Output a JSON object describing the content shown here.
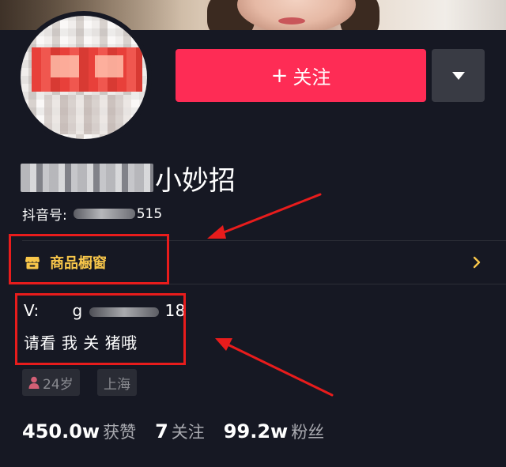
{
  "profile": {
    "follow_button_label": "关注",
    "follow_button_icon": "plus-icon",
    "more_button_icon": "dropdown-triangle-icon",
    "nickname_visible": "小妙招",
    "douyin_id_label": "抖音号:",
    "douyin_id_visible": "515"
  },
  "shop_window": {
    "label": "商品橱窗",
    "icon": "shop-icon",
    "arrow_icon": "chevron-right-icon"
  },
  "bio": {
    "line1_prefix": "V:",
    "line1_lead": "g",
    "line1_tail": "18",
    "line2": "请看 我 关 猪哦"
  },
  "tags": {
    "age": "24岁",
    "age_icon": "female-user-icon",
    "location": "上海"
  },
  "stats": [
    {
      "value": "450.0w",
      "label": "获赞"
    },
    {
      "value": "7",
      "label": "关注"
    },
    {
      "value": "99.2w",
      "label": "粉丝"
    }
  ],
  "colors": {
    "background": "#161823",
    "follow_button": "#fe2c55",
    "more_button": "#393b44",
    "shop_accent": "#f8c64a",
    "annotation_red": "#e81c1c",
    "tag_background": "#2a2c35"
  }
}
